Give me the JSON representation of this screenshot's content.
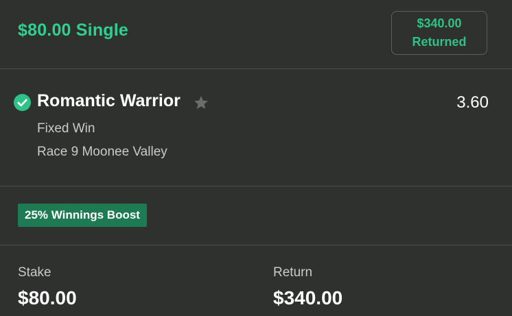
{
  "bet": {
    "title": "$80.00 Single",
    "returned_amount": "$340.00",
    "returned_label": "Returned"
  },
  "selection": {
    "name": "Romantic Warrior",
    "odds": "3.60",
    "bet_type": "Fixed Win",
    "race": "Race 9 Moonee Valley",
    "status_icon": "check-circle-icon",
    "favourite_icon": "star-icon"
  },
  "boost": {
    "label": "25% Winnings Boost"
  },
  "summary": {
    "stake_label": "Stake",
    "stake_value": "$80.00",
    "return_label": "Return",
    "return_value": "$340.00"
  },
  "colors": {
    "background": "#2f312f",
    "accent_green": "#2fd08f",
    "boost_green": "#1d7a53"
  }
}
